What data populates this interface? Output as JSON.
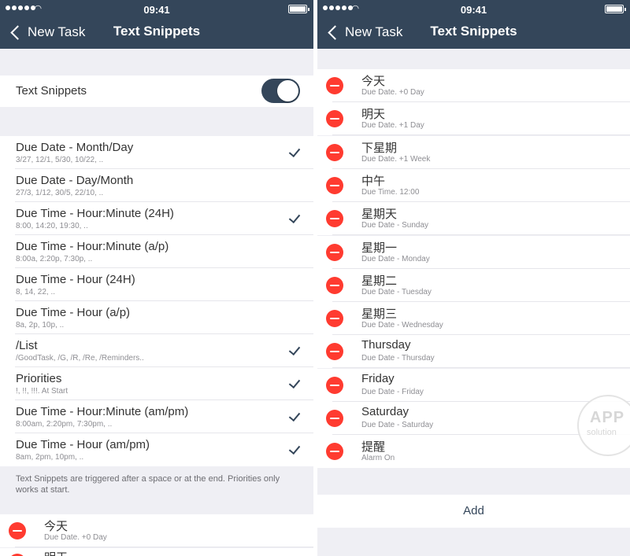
{
  "status_bar": {
    "time": "09:41"
  },
  "nav": {
    "back_label": "New Task",
    "title": "Text Snippets"
  },
  "settings": {
    "toggle_label": "Text Snippets",
    "toggle_on": true,
    "options": [
      {
        "title": "Due Date - Month/Day",
        "subtitle": "3/27, 12/1, 5/30, 10/22, ..",
        "checked": true
      },
      {
        "title": "Due Date - Day/Month",
        "subtitle": "27/3, 1/12, 30/5, 22/10, ..",
        "checked": false
      },
      {
        "title": "Due Time - Hour:Minute (24H)",
        "subtitle": "8:00, 14:20, 19:30, ..",
        "checked": true
      },
      {
        "title": "Due Time - Hour:Minute (a/p)",
        "subtitle": "8:00a, 2:20p, 7:30p, ..",
        "checked": false
      },
      {
        "title": "Due Time - Hour (24H)",
        "subtitle": "8, 14, 22, ..",
        "checked": false
      },
      {
        "title": "Due Time - Hour (a/p)",
        "subtitle": "8a, 2p, 10p, ..",
        "checked": false
      },
      {
        "title": "/List",
        "subtitle": "/GoodTask, /G, /R, /Re, /Reminders..",
        "checked": true
      },
      {
        "title": "Priorities",
        "subtitle": "!, !!, !!!. At Start",
        "checked": true
      },
      {
        "title": "Due Time - Hour:Minute (am/pm)",
        "subtitle": "8:00am, 2:20pm, 7:30pm, ..",
        "checked": true
      },
      {
        "title": "Due Time - Hour (am/pm)",
        "subtitle": "8am, 2pm, 10pm, ..",
        "checked": true
      }
    ],
    "footer_note": "Text Snippets are triggered after a space or at the end. Priorities only works at start."
  },
  "snippets": [
    {
      "title": "今天",
      "subtitle": "Due Date. +0 Day"
    },
    {
      "title": "明天",
      "subtitle": "Due Date. +1 Day"
    },
    {
      "title": "下星期",
      "subtitle": "Due Date. +1 Week"
    },
    {
      "title": "中午",
      "subtitle": "Due Time. 12:00"
    },
    {
      "title": "星期天",
      "subtitle": "Due Date - Sunday"
    },
    {
      "title": "星期一",
      "subtitle": "Due Date - Monday"
    },
    {
      "title": "星期二",
      "subtitle": "Due Date - Tuesday"
    },
    {
      "title": "星期三",
      "subtitle": "Due Date - Wednesday"
    },
    {
      "title": "Thursday",
      "subtitle": "Due Date - Thursday"
    },
    {
      "title": "Friday",
      "subtitle": "Due Date - Friday"
    },
    {
      "title": "Saturday",
      "subtitle": "Due Date - Saturday"
    },
    {
      "title": "提醒",
      "subtitle": "Alarm On"
    }
  ],
  "left_partial_next_title": "明天",
  "add_label": "Add",
  "watermark": {
    "line1": "APP",
    "line2": "solution"
  },
  "colors": {
    "nav_bar": "#34465a",
    "delete": "#ff3b30",
    "background": "#efeff4",
    "checkmark": "#34465a"
  }
}
